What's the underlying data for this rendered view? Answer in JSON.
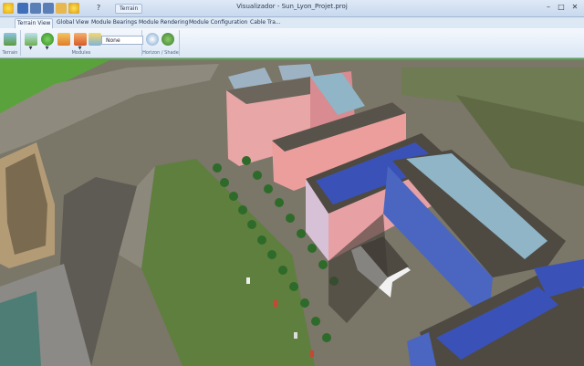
{
  "window": {
    "title": "Visualizador - Sun_Lyon_Projet.proj",
    "minimize_glyph": "–",
    "maximize_glyph": "□",
    "close_glyph": "✕"
  },
  "quick_access": {
    "small_button_label": "Terrain",
    "help_glyph": "?"
  },
  "tabs": [
    {
      "label": "Terrain View"
    },
    {
      "label": "Global View"
    },
    {
      "label": "Module Bearings"
    },
    {
      "label": "Module Rendering"
    },
    {
      "label": "Module Configuration"
    },
    {
      "label": "Cable Tra..."
    }
  ],
  "ribbon": {
    "groups": [
      {
        "label": "Terrain"
      },
      {
        "label": "Modules"
      },
      {
        "label": "Horizon / Shade"
      }
    ],
    "name_select_value": "None"
  },
  "icons": {
    "app": "sun-logo-icon",
    "save": "save-icon",
    "undo": "undo-icon",
    "redo": "redo-icon",
    "folder": "folder-icon",
    "sun": "sun-icon",
    "tree": "tree-icon",
    "horizon": "horizon-icon"
  },
  "colors": {
    "ribbon_bg": "#dbe7f5",
    "terrain_green": "#5aa33c",
    "roof_dark": "#4e4a42",
    "facade_pink": "#e59aa0",
    "solar_blue": "#3a52b8"
  }
}
